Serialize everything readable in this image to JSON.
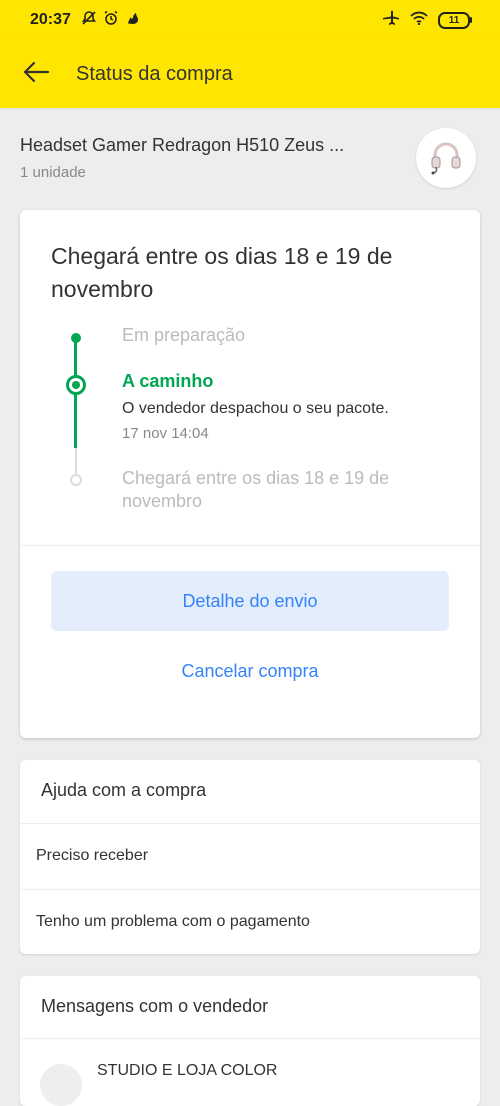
{
  "status_bar": {
    "time": "20:37",
    "battery": "11"
  },
  "header": {
    "title": "Status da compra"
  },
  "product": {
    "name": "Headset Gamer Redragon H510 Zeus ...",
    "quantity": "1 unidade"
  },
  "shipment": {
    "title": "Chegará entre os dias 18 e 19 de novembro",
    "steps": [
      {
        "label": "Em preparação",
        "state": "done"
      },
      {
        "label": "A caminho",
        "state": "current",
        "description": "O vendedor despachou o seu pacote.",
        "date": "17 nov 14:04"
      },
      {
        "label": "Chegará entre os dias 18 e 19 de novembro",
        "state": "pending"
      }
    ],
    "details_button": "Detalhe do envio",
    "cancel_button": "Cancelar compra"
  },
  "help": {
    "title": "Ajuda com a compra",
    "items": [
      "Preciso receber",
      "Tenho um problema com o pagamento"
    ]
  },
  "messages": {
    "title": "Mensagens com o vendedor",
    "seller_name": "STUDIO E LOJA COLOR"
  },
  "colors": {
    "brand_yellow": "#ffe600",
    "success_green": "#00a650",
    "link_blue": "#3483fa",
    "button_bg": "#e3edfb"
  }
}
